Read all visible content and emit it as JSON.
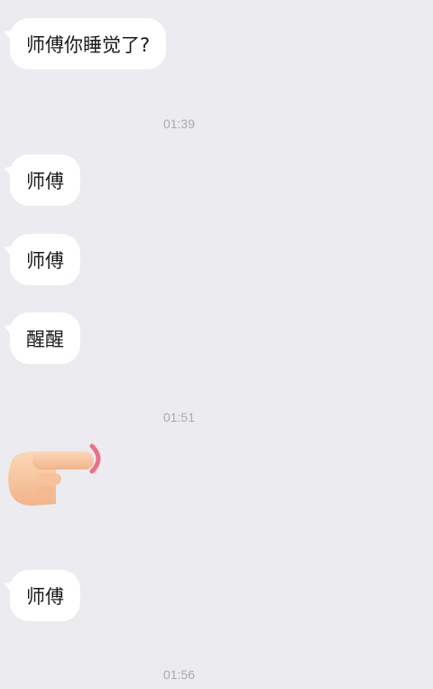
{
  "messages": [
    {
      "text": "师傅你睡觉了?"
    },
    {
      "text": "师傅"
    },
    {
      "text": "师傅"
    },
    {
      "text": "醒醒"
    },
    {
      "text": "师傅"
    }
  ],
  "timestamps": [
    "01:39",
    "01:51",
    "01:56"
  ],
  "sticker": {
    "icon": "pointing-finger-icon"
  },
  "colors": {
    "background": "#ebebf0",
    "bubble": "#ffffff",
    "text": "#1a1a1a",
    "timestamp": "#a9a9ae",
    "skin": "#f7c8a2",
    "motion_line": "#ef6e86"
  }
}
